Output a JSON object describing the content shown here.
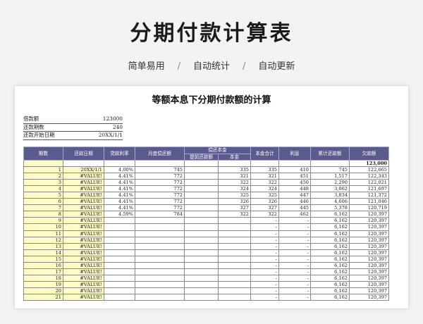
{
  "header": {
    "title": "分期付款计算表",
    "tags": [
      "简单易用",
      "自动统计",
      "自动更新"
    ],
    "separator": "/"
  },
  "sheet": {
    "title": "等额本息下分期付款额的计算",
    "info": [
      {
        "label": "借款额",
        "value": "123000"
      },
      {
        "label": "还款期数",
        "value": "240"
      },
      {
        "label": "还款开始日期",
        "value": "20XX/1/1"
      }
    ],
    "columns": {
      "period": "期数",
      "date": "还款日期",
      "rate": "贷款利率",
      "monthly": "月度偿还额",
      "principal_group": "偿还本金",
      "prepay": "提前还款额",
      "principal": "本金",
      "principal_total": "本金合计",
      "interest": "利息",
      "cum": "累计还款额",
      "owed": "欠款额"
    },
    "initial_balance": "123,000",
    "rows": [
      [
        "1",
        "20XX/1/1",
        "4.00%",
        "745",
        "",
        "335",
        "335",
        "410",
        "745",
        "122,665"
      ],
      [
        "2",
        "#VALUE!",
        "4.41%",
        "772",
        "",
        "321",
        "321",
        "451",
        "1,517",
        "122,343"
      ],
      [
        "3",
        "#VALUE!",
        "4.41%",
        "772",
        "",
        "322",
        "322",
        "450",
        "2,290",
        "122,021"
      ],
      [
        "4",
        "#VALUE!",
        "4.41%",
        "772",
        "",
        "324",
        "324",
        "448",
        "3,062",
        "121,697"
      ],
      [
        "5",
        "#VALUE!",
        "4.41%",
        "772",
        "",
        "325",
        "325",
        "447",
        "3,834",
        "121,372"
      ],
      [
        "6",
        "#VALUE!",
        "4.41%",
        "772",
        "",
        "326",
        "326",
        "446",
        "4,606",
        "121,046"
      ],
      [
        "7",
        "#VALUE!",
        "4.41%",
        "772",
        "",
        "327",
        "327",
        "445",
        "5,378",
        "120,719"
      ],
      [
        "8",
        "#VALUE!",
        "4.59%",
        "784",
        "",
        "322",
        "322",
        "462",
        "6,162",
        "120,397"
      ],
      [
        "9",
        "#VALUE!",
        "",
        "",
        "",
        "",
        "-",
        "-",
        "6,162",
        "120,397"
      ],
      [
        "10",
        "#VALUE!",
        "",
        "",
        "",
        "",
        "-",
        "-",
        "6,162",
        "120,397"
      ],
      [
        "11",
        "#VALUE!",
        "",
        "",
        "",
        "",
        "-",
        "-",
        "6,162",
        "120,397"
      ],
      [
        "12",
        "#VALUE!",
        "",
        "",
        "",
        "",
        "-",
        "-",
        "6,162",
        "120,397"
      ],
      [
        "13",
        "#VALUE!",
        "",
        "",
        "",
        "",
        "-",
        "-",
        "6,162",
        "120,397"
      ],
      [
        "14",
        "#VALUE!",
        "",
        "",
        "",
        "",
        "-",
        "-",
        "6,162",
        "120,397"
      ],
      [
        "15",
        "#VALUE!",
        "",
        "",
        "",
        "",
        "-",
        "-",
        "6,162",
        "120,397"
      ],
      [
        "16",
        "#VALUE!",
        "",
        "",
        "",
        "",
        "-",
        "-",
        "6,162",
        "120,397"
      ],
      [
        "17",
        "#VALUE!",
        "",
        "",
        "",
        "",
        "-",
        "-",
        "6,162",
        "120,397"
      ],
      [
        "18",
        "#VALUE!",
        "",
        "",
        "",
        "",
        "-",
        "-",
        "6,162",
        "120,397"
      ],
      [
        "19",
        "#VALUE!",
        "",
        "",
        "",
        "",
        "-",
        "-",
        "6,162",
        "120,397"
      ],
      [
        "20",
        "#VALUE!",
        "",
        "",
        "",
        "",
        "-",
        "-",
        "6,162",
        "120,397"
      ],
      [
        "21",
        "#VALUE!",
        "",
        "",
        "",
        "",
        "-",
        "-",
        "6,162",
        "120,397"
      ]
    ],
    "colors": {
      "header_bg": "#5b5a8e",
      "highlight": "#fdfbc6"
    }
  }
}
